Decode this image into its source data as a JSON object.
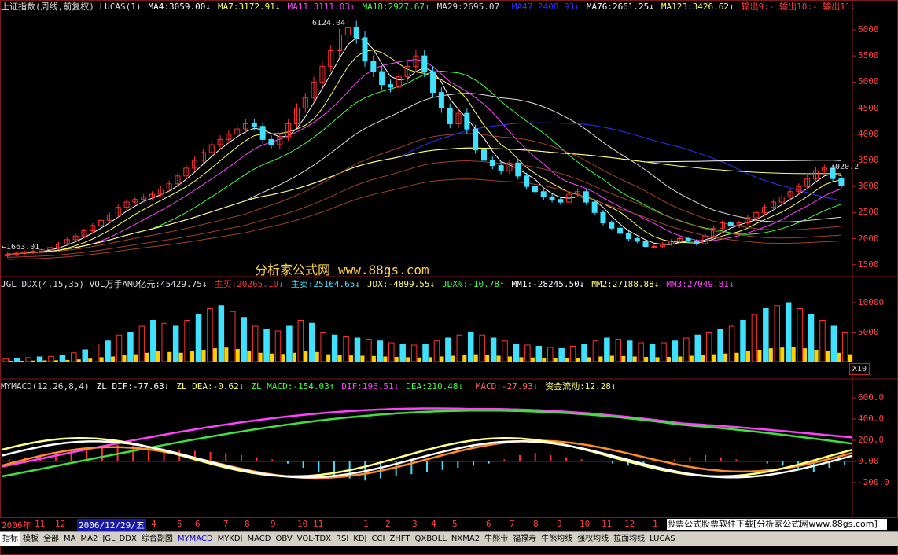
{
  "main_header": [
    {
      "text": "上证指数(周线,前复权) LUCAS(1)",
      "color": "#dddddd"
    },
    {
      "text": "MA4:3059.00↓",
      "color": "#ffffff"
    },
    {
      "text": "MA7:3172.91↓",
      "color": "#ffff60"
    },
    {
      "text": "MA11:3111.03↑",
      "color": "#ff40ff"
    },
    {
      "text": "MA18:2927.67↑",
      "color": "#40ff40"
    },
    {
      "text": "MA29:2695.07↑",
      "color": "#dddddd"
    },
    {
      "text": "MA47:2408.93↑",
      "color": "#3030ff"
    },
    {
      "text": "MA76:2661.25↓",
      "color": "#ffffff"
    },
    {
      "text": "MA123:3426.62↑",
      "color": "#ffff60"
    },
    {
      "text": "输出9:- 输出10:- 输出11:",
      "color": "#ff4040"
    }
  ],
  "vol_header": [
    {
      "text": "JGL_DDX(4,15,35) VOL万手AMO亿元:45429.75↓",
      "color": "#dddddd"
    },
    {
      "text": "主买:20265.10↓",
      "color": "#ff3030"
    },
    {
      "text": "主卖:25164.65↓",
      "color": "#40e0ff"
    },
    {
      "text": "JDX:-4899.55↓",
      "color": "#ffff60"
    },
    {
      "text": "JDX%:-10.78↑",
      "color": "#40ff40"
    },
    {
      "text": "MM1:-28245.50↓",
      "color": "#ffffff"
    },
    {
      "text": "MM2:27188.88↓",
      "color": "#ffff60"
    },
    {
      "text": "MM3:27049.81↓",
      "color": "#ff40ff"
    }
  ],
  "macd_header": [
    {
      "text": "MYMACD(12,26,8,4)",
      "color": "#dddddd"
    },
    {
      "text": "ZL_DIF:-77.63↓",
      "color": "#ffffff"
    },
    {
      "text": "ZL_DEA:-0.62↓",
      "color": "#ffff60"
    },
    {
      "text": "ZL_MACD:-154.03↑",
      "color": "#40ff40"
    },
    {
      "text": "DIF:196.51↓",
      "color": "#ff40ff"
    },
    {
      "text": "DEA:210.48↓",
      "color": "#40ff40"
    },
    {
      "text": "_MACD:-27.93↓",
      "color": "#ff6060"
    },
    {
      "text": "资金流动:12.28↓",
      "color": "#ffff60"
    }
  ],
  "price_ticks": [
    "6000",
    "5500",
    "5000",
    "4500",
    "4000",
    "3500",
    "3000",
    "2500",
    "2000",
    "1500"
  ],
  "vol_ticks": [
    "10000",
    "5000"
  ],
  "macd_ticks": [
    "600.0",
    "400.0",
    "200.0",
    "0.00",
    "-200.0"
  ],
  "annotations": {
    "high": "6124.04",
    "low": "1663.01",
    "last": "3020.2"
  },
  "watermark": {
    "cn": "分析家公式网",
    "url": "www.88gs.com"
  },
  "x10_label": "X10",
  "time_labels": [
    "2006年",
    "11",
    "12",
    "2006/12/29/五",
    "4",
    "5",
    "6",
    "7",
    "8",
    "9",
    "10",
    "11",
    "1",
    "2",
    "3",
    "4",
    "5",
    "6",
    "7",
    "8",
    "9",
    "10",
    "11",
    "12",
    "1",
    "2",
    "3"
  ],
  "promo": "股票公式股票软件下载[分析家公式网www.88gs.com]",
  "tabs": [
    "指标",
    "模板",
    "全部",
    "MA",
    "MA2",
    "JGL_DDX",
    "综合副图",
    "MYMACD",
    "MYKDJ",
    "MACD",
    "OBV",
    "VOL-TDX",
    "RSI",
    "KDJ",
    "CCI",
    "ZHFT",
    "QXBOLL",
    "NXMA2",
    "牛熊带",
    "福禄寿",
    "牛熊均线",
    "强权均线",
    "拉面均线",
    "LUCAS"
  ],
  "active_tab": "MYMACD",
  "colors": {
    "up": "#ff3030",
    "down": "#40e0ff",
    "grid": "#7a1a1a",
    "axis_text": "#ff4040"
  },
  "chart_data": {
    "type": "candlestick",
    "period": "weekly",
    "symbol": "上证指数",
    "ylim": [
      1300,
      6300
    ],
    "weekly_close": [
      1700,
      1720,
      1740,
      1760,
      1790,
      1830,
      1900,
      1980,
      2050,
      2150,
      2250,
      2350,
      2450,
      2600,
      2700,
      2750,
      2800,
      2850,
      2950,
      3050,
      3200,
      3350,
      3500,
      3650,
      3800,
      3900,
      4000,
      4100,
      4200,
      4150,
      3900,
      3800,
      3950,
      4200,
      4500,
      4700,
      5000,
      5300,
      5600,
      5900,
      6050,
      5850,
      5400,
      5200,
      4950,
      4900,
      5100,
      5300,
      5500,
      5200,
      4800,
      4500,
      4200,
      4400,
      4100,
      3700,
      3500,
      3400,
      3300,
      3450,
      3200,
      3000,
      2900,
      2800,
      2750,
      2700,
      2850,
      2900,
      2700,
      2500,
      2300,
      2200,
      2100,
      2000,
      1950,
      1850,
      1850,
      1900,
      1950,
      2000,
      1950,
      1900,
      2050,
      2200,
      2300,
      2250,
      2300,
      2400,
      2500,
      2600,
      2700,
      2800,
      2900,
      3000,
      3150,
      3300,
      3350,
      3150,
      3020
    ],
    "volume_approx": [
      500,
      550,
      700,
      800,
      900,
      1100,
      1500,
      2000,
      3000,
      3500,
      4500,
      5000,
      6000,
      7000,
      6500,
      6000,
      7000,
      8000,
      9000,
      9500,
      8500,
      7500,
      6000,
      5500,
      5200,
      6000,
      7000,
      6500,
      5000,
      4500,
      4200,
      4000,
      3800,
      3500,
      3200,
      3000,
      2800,
      3000,
      3500,
      4000,
      4500,
      5000,
      4500,
      4000,
      3500,
      3000,
      2800,
      2600,
      2400,
      2200,
      2600,
      3000,
      3500,
      4000,
      3800,
      3500,
      3200,
      3000,
      3200,
      3500,
      4000,
      4500,
      5000,
      5500,
      6000,
      7000,
      8000,
      9000,
      9500,
      10000,
      9000,
      8000,
      7000,
      6000,
      5000
    ],
    "macd_bar_approx": [
      20,
      40,
      60,
      80,
      100,
      120,
      140,
      160,
      150,
      130,
      120,
      110,
      100,
      90,
      80,
      60,
      40,
      20,
      -20,
      -60,
      -100,
      -140,
      -160,
      -180,
      -160,
      -140,
      -120,
      -100,
      -80,
      -60,
      -40,
      -20,
      20,
      60,
      80,
      60,
      40,
      20,
      0,
      -20,
      -40,
      -20,
      0,
      20,
      40,
      60,
      40,
      20,
      0,
      -20,
      -40,
      -80,
      -100,
      -60,
      -30
    ]
  }
}
